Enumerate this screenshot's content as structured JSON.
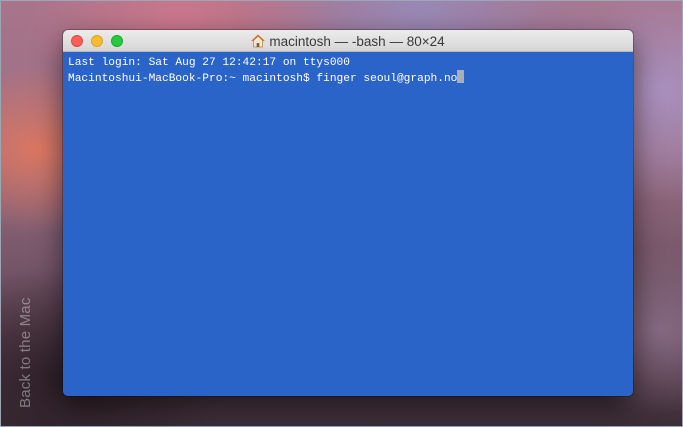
{
  "watermark": "Back to the Mac",
  "window": {
    "title": "macintosh — -bash — 80×24",
    "icons": {
      "title_icon": "home-icon",
      "close": "close-icon",
      "minimize": "minimize-icon",
      "zoom": "zoom-icon"
    }
  },
  "terminal": {
    "lines": [
      "Last login: Sat Aug 27 12:42:17 on ttys000",
      "Macintoshui-MacBook-Pro:~ macintosh$ finger seoul@graph.no"
    ],
    "background_color": "#2b64c9",
    "text_color": "#ffffff"
  }
}
